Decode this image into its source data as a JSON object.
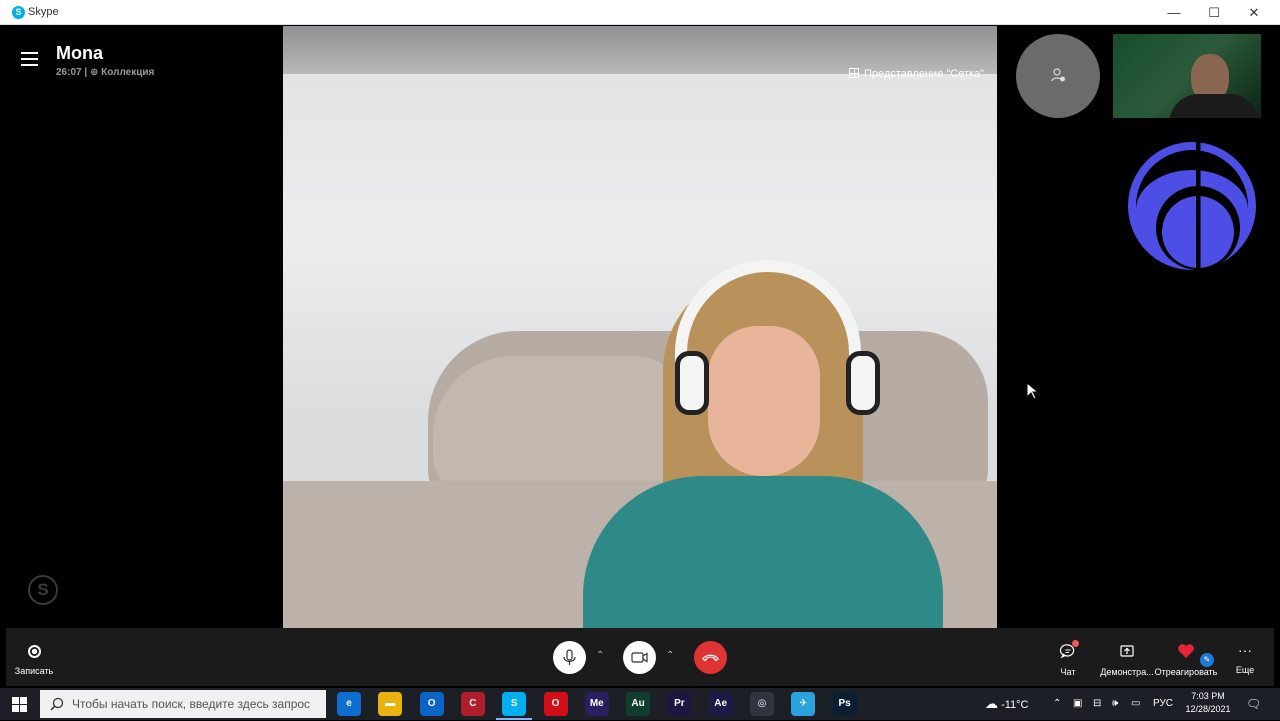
{
  "window": {
    "title": "Skype",
    "minimize": "—",
    "maximize": "☐",
    "close": "✕"
  },
  "call": {
    "contact_name": "Mona",
    "duration": "26:07",
    "separator": "|",
    "collection_label": "Коллекция",
    "grid_view_label": "Представление \"Сетка\""
  },
  "toolbar": {
    "record_label": "Записать",
    "chat_label": "Чат",
    "share_label": "Демонстра...",
    "react_label": "Отреагировать",
    "more_label": "Еще"
  },
  "taskbar": {
    "search_placeholder": "Чтобы начать поиск, введите здесь запрос",
    "weather": "-11°C",
    "language": "РУС",
    "time": "7:03 PM",
    "date": "12/28/2021",
    "apps": [
      {
        "label": "e",
        "color": "#0c6fcf"
      },
      {
        "label": "▬",
        "color": "#e8b30e"
      },
      {
        "label": "O",
        "color": "#0a64c8"
      },
      {
        "label": "C",
        "color": "#b21d2b"
      },
      {
        "label": "S",
        "color": "#00aff0"
      },
      {
        "label": "O",
        "color": "#d20f19"
      },
      {
        "label": "Me",
        "color": "#2a1e61"
      },
      {
        "label": "Au",
        "color": "#0f3e2e"
      },
      {
        "label": "Pr",
        "color": "#1c1642"
      },
      {
        "label": "Ae",
        "color": "#1d1a48"
      },
      {
        "label": "◎",
        "color": "#2f3440"
      },
      {
        "label": "✈",
        "color": "#2aa2dd"
      },
      {
        "label": "Ps",
        "color": "#0a1e33"
      }
    ]
  },
  "colors": {
    "accent": "#00aff0",
    "end_call": "#e03333",
    "avatar_blue": "#4c4ee6"
  }
}
